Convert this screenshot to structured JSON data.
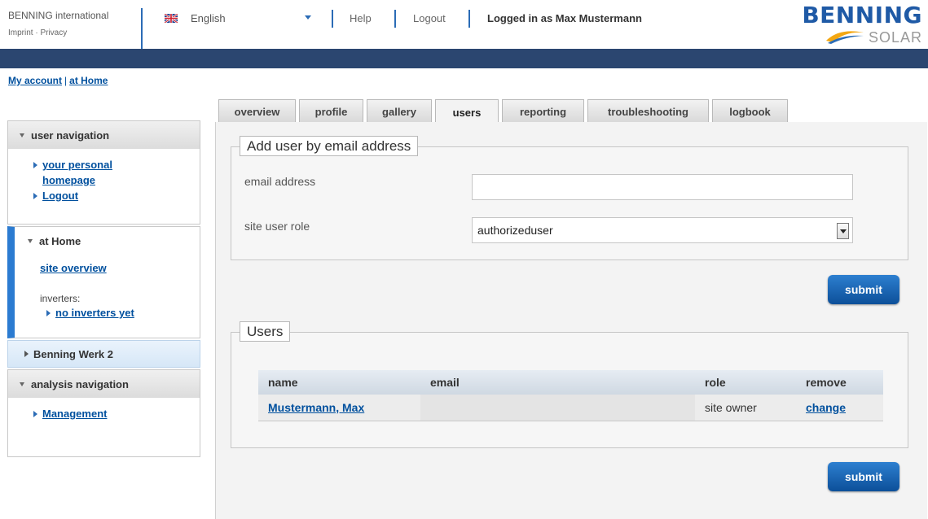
{
  "header": {
    "brand": "BENNING international",
    "imprint": "Imprint",
    "privacy": "Privacy",
    "link_sep": " · ",
    "language": "English",
    "help": "Help",
    "logout": "Logout",
    "logged_in": "Logged in as Max Mustermann",
    "logo_main": "BENNING",
    "logo_sub": "SOLAR"
  },
  "breadcrumb": {
    "my_account": "My account",
    "sep": "|",
    "at_home": "at Home"
  },
  "tabs": [
    {
      "label": "overview",
      "active": false
    },
    {
      "label": "profile",
      "active": false
    },
    {
      "label": "gallery",
      "active": false
    },
    {
      "label": "users",
      "active": true
    },
    {
      "label": "reporting",
      "active": false
    },
    {
      "label": "troubleshooting",
      "active": false
    },
    {
      "label": "logbook",
      "active": false
    }
  ],
  "sidebar": {
    "user_nav": {
      "title": "user navigation",
      "link1_line1": "your personal",
      "link1_line2": "homepage",
      "link2": "Logout"
    },
    "home": {
      "title": "at Home",
      "site_overview": "site overview",
      "inverters_label": "inverters:",
      "no_inverters": "no inverters yet"
    },
    "werk": "Benning Werk 2",
    "analysis": {
      "title": "analysis navigation",
      "management": "Management"
    }
  },
  "add_user": {
    "legend": "Add user by email address",
    "email_label": "email address",
    "email_value": "",
    "role_label": "site user role",
    "role_value": "authorizeduser",
    "submit": "submit"
  },
  "users": {
    "legend": "Users",
    "columns": [
      "name",
      "email",
      "role",
      "remove"
    ],
    "rows": [
      {
        "name": "Mustermann, Max",
        "email": "",
        "role": "site owner",
        "action": "change"
      }
    ],
    "submit": "submit"
  },
  "colors": {
    "header_bar": "#2b4670",
    "link": "#00509e",
    "accent": "#2b7bd1",
    "submit_button": "#1a63b2"
  }
}
